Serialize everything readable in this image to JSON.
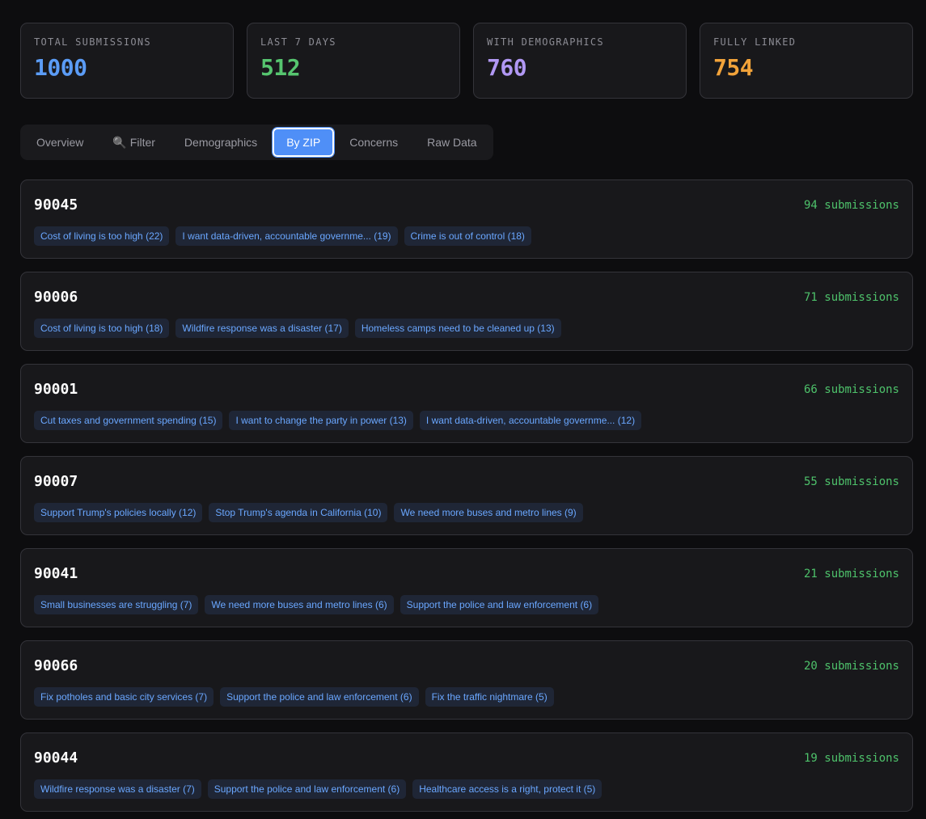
{
  "stats": [
    {
      "label": "TOTAL SUBMISSIONS",
      "value": "1000",
      "color": "#5b9cf6"
    },
    {
      "label": "LAST 7 DAYS",
      "value": "512",
      "color": "#56c56f"
    },
    {
      "label": "WITH DEMOGRAPHICS",
      "value": "760",
      "color": "#b198f4"
    },
    {
      "label": "FULLY LINKED",
      "value": "754",
      "color": "#f2a33a"
    }
  ],
  "tabs": [
    {
      "label": "Overview",
      "active": false
    },
    {
      "label": "Filter",
      "icon": "magnifier-icon",
      "active": false
    },
    {
      "label": "Demographics",
      "active": false
    },
    {
      "label": "By ZIP",
      "active": true
    },
    {
      "label": "Concerns",
      "active": false
    },
    {
      "label": "Raw Data",
      "active": false
    }
  ],
  "zips": [
    {
      "zip": "90045",
      "count": "94 submissions",
      "concerns": [
        "Cost of living is too high (22)",
        "I want data-driven, accountable governme... (19)",
        "Crime is out of control (18)"
      ]
    },
    {
      "zip": "90006",
      "count": "71 submissions",
      "concerns": [
        "Cost of living is too high (18)",
        "Wildfire response was a disaster (17)",
        "Homeless camps need to be cleaned up (13)"
      ]
    },
    {
      "zip": "90001",
      "count": "66 submissions",
      "concerns": [
        "Cut taxes and government spending (15)",
        "I want to change the party in power (13)",
        "I want data-driven, accountable governme... (12)"
      ]
    },
    {
      "zip": "90007",
      "count": "55 submissions",
      "concerns": [
        "Support Trump's policies locally (12)",
        "Stop Trump's agenda in California (10)",
        "We need more buses and metro lines (9)"
      ]
    },
    {
      "zip": "90041",
      "count": "21 submissions",
      "concerns": [
        "Small businesses are struggling (7)",
        "We need more buses and metro lines (6)",
        "Support the police and law enforcement (6)"
      ]
    },
    {
      "zip": "90066",
      "count": "20 submissions",
      "concerns": [
        "Fix potholes and basic city services (7)",
        "Support the police and law enforcement (6)",
        "Fix the traffic nightmare (5)"
      ]
    },
    {
      "zip": "90044",
      "count": "19 submissions",
      "concerns": [
        "Wildfire response was a disaster (7)",
        "Support the police and law enforcement (6)",
        "Healthcare access is a right, protect it (5)"
      ]
    }
  ]
}
